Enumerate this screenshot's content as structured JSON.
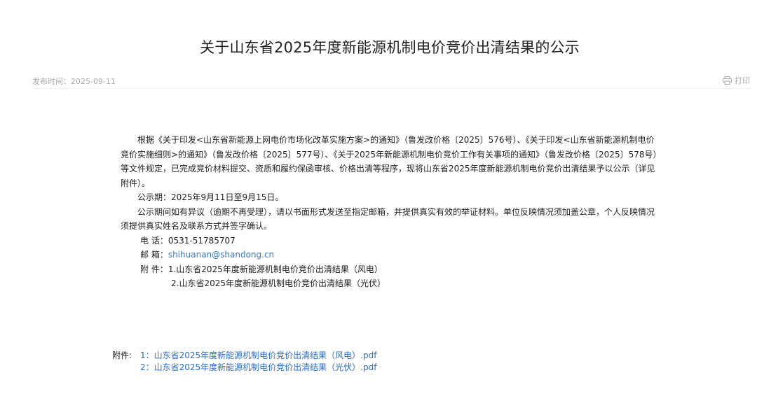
{
  "title": "关于山东省2025年度新能源机制电价竞价出清结果的公示",
  "meta": {
    "publish_label": "发布时间：",
    "publish_date": "2025-09-11",
    "print_label": "打印",
    "print_icon": "printer-icon"
  },
  "body": {
    "para1": "根据《关于印发<山东省新能源上网电价市场化改革实施方案>的通知》（鲁发改价格〔2025〕576号）、《关于印发<山东省新能源机制电价竞价实施细则>的通知》（鲁发改价格〔2025〕577号）、《关于2025年新能源机制电价竞价工作有关事项的通知》（鲁发改价格〔2025〕578号）等文件规定，已完成竞价材料提交、资质和履约保函审核、价格出清等程序，现将山东省2025年度新能源机制电价竞价出清结果予以公示（详见附件）。",
    "para2": "公示期：2025年9月11日至9月15日。",
    "para3": "公示期间如有异议（逾期不再受理），请以书面形式发送至指定邮箱，并提供真实有效的举证材料。单位反映情况须加盖公章，个人反映情况须提供真实姓名及联系方式并签字确认。",
    "phone_label": "电  话：",
    "phone": "0531-51785707",
    "email_label": "邮  箱：",
    "email": "shihuanan@shandong.cn",
    "attach_label": "附  件：",
    "attach_item1": "1.山东省2025年度新能源机制电价竞价出清结果（风电）",
    "attach_item2": "2.山东省2025年度新能源机制电价竞价出清结果（光伏）"
  },
  "attachments": {
    "label": "附件:",
    "items": [
      "1：山东省2025年度新能源机制电价竞价出清结果（风电）.pdf",
      "2：山东省2025年度新能源机制电价竞价出清结果（光伏）.pdf"
    ]
  },
  "colors": {
    "link": "#2f6dbf",
    "meta_text": "#aaaaaa"
  }
}
